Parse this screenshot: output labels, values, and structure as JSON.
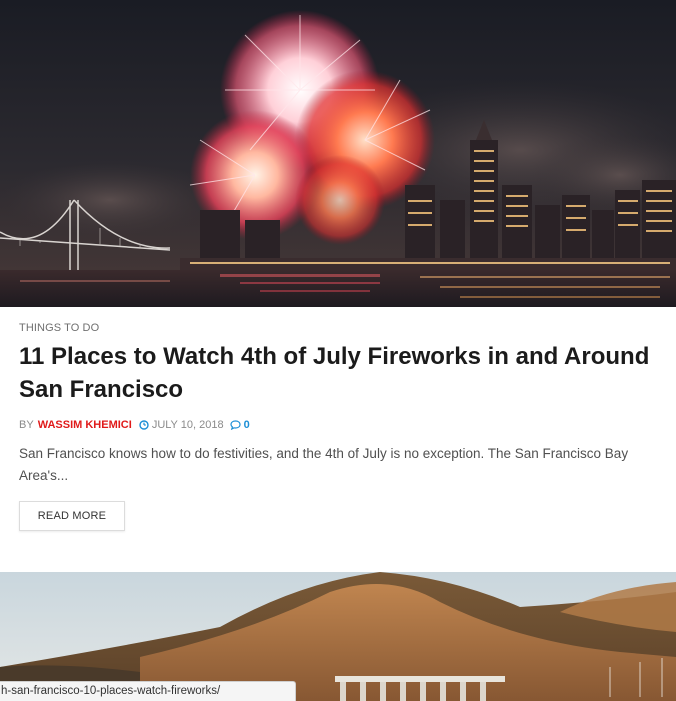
{
  "post": {
    "category": "THINGS TO DO",
    "title": "11 Places to Watch 4th of July Fireworks in and Around San Francisco",
    "meta": {
      "by": "BY",
      "author": "WASSIM KHEMICI",
      "date": "JULY 10, 2018",
      "comments": "0"
    },
    "excerpt": "San Francisco knows how to do festivities, and the 4th of July is no exception. The San Francisco Bay Area's...",
    "read_more": "READ MORE"
  },
  "status_bar": {
    "url": "h-san-francisco-10-places-watch-fireworks/"
  },
  "colors": {
    "author": "#e01a1a",
    "comments": "#1c8fd6",
    "title": "#1b1b1b"
  }
}
